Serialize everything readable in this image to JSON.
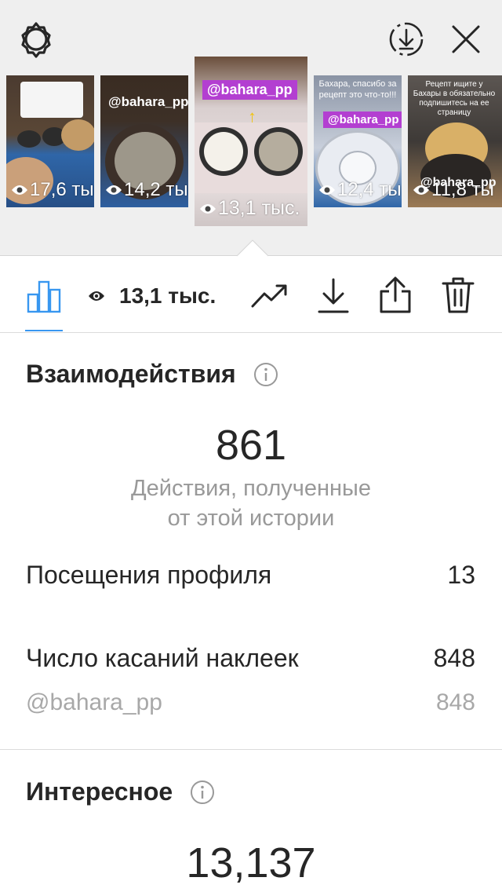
{
  "top": {
    "icons": [
      "gear-icon",
      "download-circle-icon",
      "close-icon"
    ]
  },
  "stories": [
    {
      "views": "17,6 ты",
      "caption": "",
      "tag": ""
    },
    {
      "views": "14,2 ты",
      "caption": "",
      "tag": "@bahara_pp"
    },
    {
      "views": "13,1 тыс.",
      "caption": "",
      "tag": "@bahara_pp"
    },
    {
      "views": "12,4 ты",
      "caption": "Бахара, спасибо за рецепт это что-то!!!",
      "tag": "@bahara_pp"
    },
    {
      "views": "11,8 ты",
      "caption": "Рецепт ищите у Бахары в обязательно подпишитесь на ее страницу",
      "tag": "@bahara_pp"
    }
  ],
  "toolbar": {
    "views": "13,1 тыс.",
    "icons": [
      "insights-bar-chart-icon",
      "eye-icon",
      "trending-up-icon",
      "download-icon",
      "share-icon",
      "trash-icon"
    ]
  },
  "interactions": {
    "title": "Взаимодействия",
    "total": "861",
    "subtitle_line1": "Действия, полученные",
    "subtitle_line2": "от этой истории",
    "rows": [
      {
        "label": "Посещения профиля",
        "value": "13"
      },
      {
        "label": "Число касаний наклеек",
        "value": "848"
      }
    ],
    "sub_row": {
      "label": "@bahara_pp",
      "value": "848"
    }
  },
  "discovery": {
    "title": "Интересное",
    "total": "13,137"
  },
  "colors": {
    "accent": "#3897f0",
    "tag": "#b33fd1",
    "top_bg": "#efefef"
  }
}
